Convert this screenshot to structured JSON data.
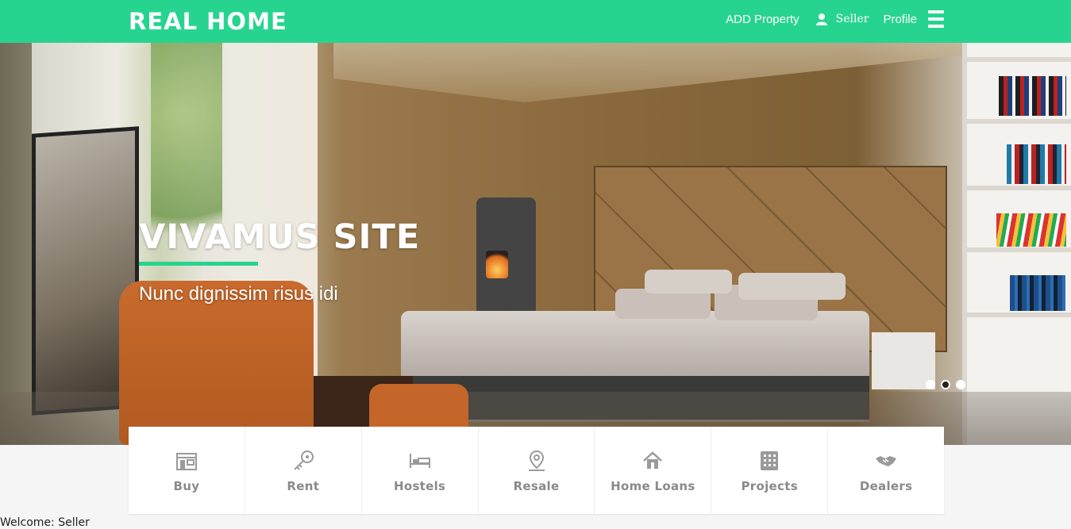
{
  "header": {
    "brand": "REAL HOME",
    "add_property": "ADD Property",
    "seller": "Seller",
    "profile": "Profile",
    "accent_color": "#27d48f"
  },
  "hero": {
    "title": "VIVAMUS SITE",
    "subtitle": "Nunc dignissim risus idi",
    "slides": 3,
    "active_slide": 2
  },
  "categories": [
    {
      "label": "Buy",
      "icon": "store-icon"
    },
    {
      "label": "Rent",
      "icon": "key-icon"
    },
    {
      "label": "Hostels",
      "icon": "bed-icon"
    },
    {
      "label": "Resale",
      "icon": "map-pin-icon"
    },
    {
      "label": "Home Loans",
      "icon": "house-icon"
    },
    {
      "label": "Projects",
      "icon": "building-icon"
    },
    {
      "label": "Dealers",
      "icon": "handshake-icon"
    }
  ],
  "footer": {
    "welcome": "Welcome: Seller"
  }
}
